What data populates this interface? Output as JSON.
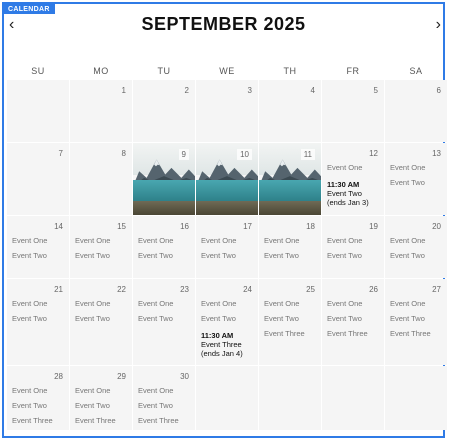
{
  "header": {
    "tag": "CALENDAR",
    "month_title": "SEPTEMBER 2025",
    "prev": "‹",
    "next": "›"
  },
  "weekdays": [
    "SU",
    "MO",
    "TU",
    "WE",
    "TH",
    "FR",
    "SA"
  ],
  "weeks": [
    [
      {
        "day": ""
      },
      {
        "day": "1"
      },
      {
        "day": "2"
      },
      {
        "day": "3"
      },
      {
        "day": "4"
      },
      {
        "day": "5"
      },
      {
        "day": "6"
      }
    ],
    [
      {
        "day": "7"
      },
      {
        "day": "8"
      },
      {
        "day": "9",
        "photo": true
      },
      {
        "day": "10",
        "photo": true
      },
      {
        "day": "11",
        "photo": true
      },
      {
        "day": "12",
        "events": [
          {
            "text": "Event One"
          },
          {
            "time": "11:30 AM",
            "text": "Event Two",
            "note": "(ends Jan 3)"
          }
        ]
      },
      {
        "day": "13",
        "events": [
          {
            "text": "Event One"
          },
          {
            "text": "Event Two"
          }
        ]
      }
    ],
    [
      {
        "day": "14",
        "events": [
          {
            "text": "Event One"
          },
          {
            "text": "Event Two"
          }
        ]
      },
      {
        "day": "15",
        "events": [
          {
            "text": "Event One"
          },
          {
            "text": "Event Two"
          }
        ]
      },
      {
        "day": "16",
        "events": [
          {
            "text": "Event One"
          },
          {
            "text": "Event Two"
          }
        ]
      },
      {
        "day": "17",
        "events": [
          {
            "text": "Event One"
          },
          {
            "text": "Event Two"
          }
        ]
      },
      {
        "day": "18",
        "events": [
          {
            "text": "Event One"
          },
          {
            "text": "Event Two"
          }
        ]
      },
      {
        "day": "19",
        "events": [
          {
            "text": "Event One"
          },
          {
            "text": "Event Two"
          }
        ]
      },
      {
        "day": "20",
        "events": [
          {
            "text": "Event One"
          },
          {
            "text": "Event Two"
          }
        ]
      }
    ],
    [
      {
        "day": "21",
        "events": [
          {
            "text": "Event One"
          },
          {
            "text": "Event Two"
          }
        ]
      },
      {
        "day": "22",
        "events": [
          {
            "text": "Event One"
          },
          {
            "text": "Event Two"
          }
        ]
      },
      {
        "day": "23",
        "events": [
          {
            "text": "Event One"
          },
          {
            "text": "Event Two"
          }
        ]
      },
      {
        "day": "24",
        "events": [
          {
            "text": "Event One"
          },
          {
            "text": "Event Two"
          },
          {
            "time": "11:30 AM",
            "text": "Event Three",
            "note": "(ends Jan 4)"
          }
        ]
      },
      {
        "day": "25",
        "events": [
          {
            "text": "Event One"
          },
          {
            "text": "Event Two"
          },
          {
            "text": "Event Three"
          }
        ]
      },
      {
        "day": "26",
        "events": [
          {
            "text": "Event One"
          },
          {
            "text": "Event Two"
          },
          {
            "text": "Event Three"
          }
        ]
      },
      {
        "day": "27",
        "events": [
          {
            "text": "Event One"
          },
          {
            "text": "Event Two"
          },
          {
            "text": "Event Three"
          }
        ]
      }
    ],
    [
      {
        "day": "28",
        "events": [
          {
            "text": "Event One"
          },
          {
            "text": "Event Two"
          },
          {
            "text": "Event Three"
          }
        ]
      },
      {
        "day": "29",
        "events": [
          {
            "text": "Event One"
          },
          {
            "text": "Event Two"
          },
          {
            "text": "Event Three"
          }
        ]
      },
      {
        "day": "30",
        "events": [
          {
            "text": "Event One"
          },
          {
            "text": "Event Two"
          },
          {
            "text": "Event Three"
          }
        ]
      },
      {
        "day": ""
      },
      {
        "day": ""
      },
      {
        "day": ""
      },
      {
        "day": ""
      }
    ]
  ],
  "colors": {
    "accent": "#2f7be6",
    "cell_bg": "#f5f5f5"
  }
}
